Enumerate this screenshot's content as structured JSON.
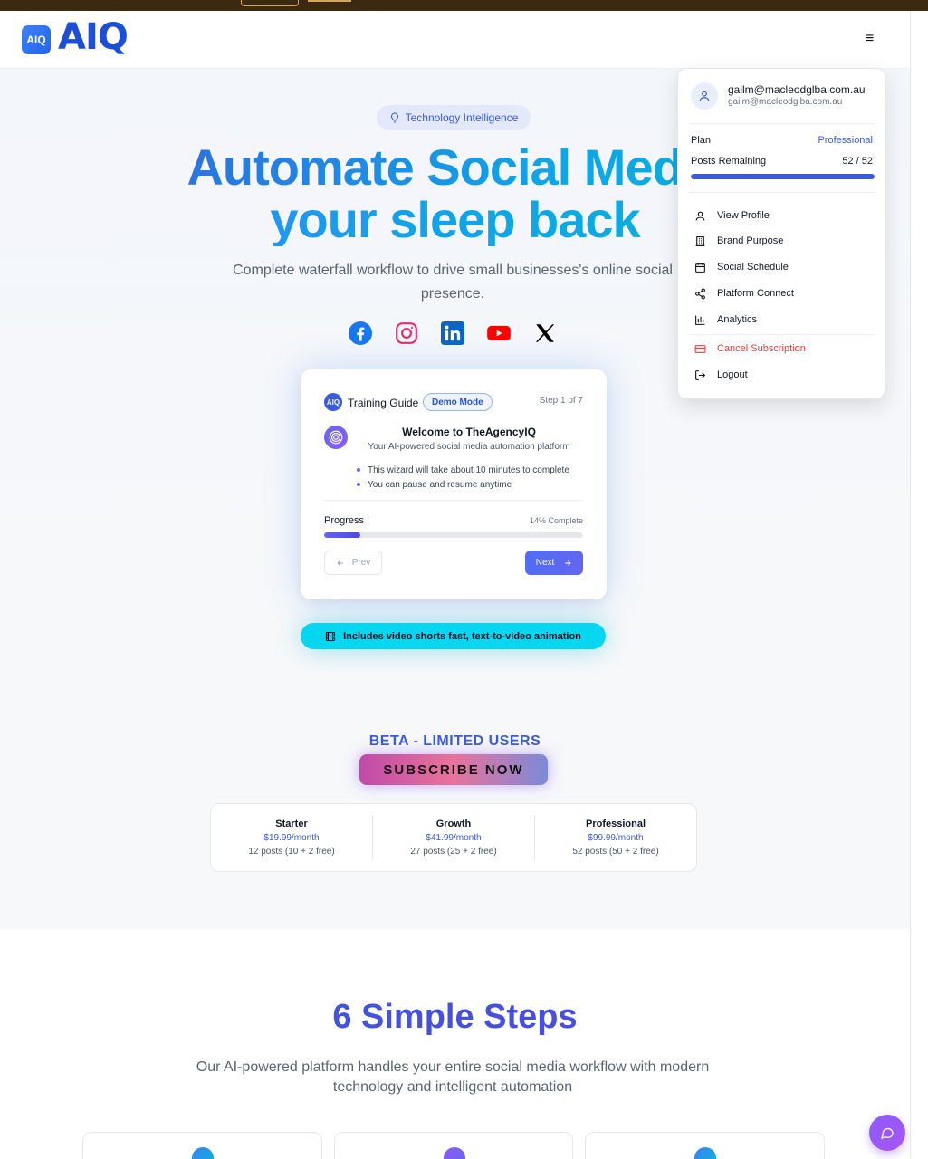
{
  "header": {
    "logo_badge": "AIQ",
    "logo_word": "AIQ",
    "menu_icon": "hamburger-icon"
  },
  "hero": {
    "chip": "Technology Intelligence",
    "headline_line1": "Automate Social Media",
    "headline_line2": "your sleep back",
    "subtitle": "Complete waterfall workflow to drive small businesses's online social presence.",
    "socials": [
      "facebook-icon",
      "instagram-icon",
      "linkedin-icon",
      "youtube-icon",
      "x-icon"
    ]
  },
  "guide": {
    "badge": "AIQ",
    "title": "Training Guide",
    "demo": "Demo Mode",
    "step": "Step 1 of 7",
    "welcome": "Welcome to TheAgencyIQ",
    "desc": "Your AI-powered social media automation platform",
    "bullets": [
      "This wizard will take about 10 minutes to complete",
      "You can pause and resume anytime"
    ],
    "progress_label": "Progress",
    "progress_text": "14% Complete",
    "progress_value": 0.14,
    "prev": "Prev",
    "next": "Next"
  },
  "video_pill": "Includes video shorts fast, text-to-video animation",
  "beta": {
    "title": "BETA - LIMITED USERS",
    "subscribe": "SUBSCRIBE NOW",
    "plans": [
      {
        "name": "Starter",
        "price": "$19.99/month",
        "posts": "12 posts (10 + 2 free)"
      },
      {
        "name": "Growth",
        "price": "$41.99/month",
        "posts": "27 posts (25 + 2 free)"
      },
      {
        "name": "Professional",
        "price": "$99.99/month",
        "posts": "52 posts (50 + 2 free)"
      }
    ]
  },
  "steps": {
    "title": "6 Simple Steps",
    "desc": "Our AI-powered platform handles your entire social media workflow with modern technology and intelligent automation"
  },
  "account_menu": {
    "name": "gailm@macleodglba.com.au",
    "email": "gailm@macleodglba.com.au",
    "plan_label": "Plan",
    "plan_value": "Professional",
    "posts_label": "Posts Remaining",
    "posts_value": "52 / 52",
    "posts_fraction": 1.0,
    "items": [
      {
        "label": "View Profile",
        "icon": "user-icon"
      },
      {
        "label": "Brand Purpose",
        "icon": "building-icon"
      },
      {
        "label": "Social Schedule",
        "icon": "calendar-icon"
      },
      {
        "label": "Platform Connect",
        "icon": "share-icon"
      },
      {
        "label": "Analytics",
        "icon": "bar-chart-icon"
      },
      {
        "label": "Cancel Subscription",
        "icon": "credit-card-icon"
      },
      {
        "label": "Logout",
        "icon": "logout-icon"
      }
    ]
  },
  "colors": {
    "brand": "#3b5bdb",
    "accent": "#06d6f0",
    "danger": "#e53e3e",
    "chat": "#8b5cf6"
  }
}
